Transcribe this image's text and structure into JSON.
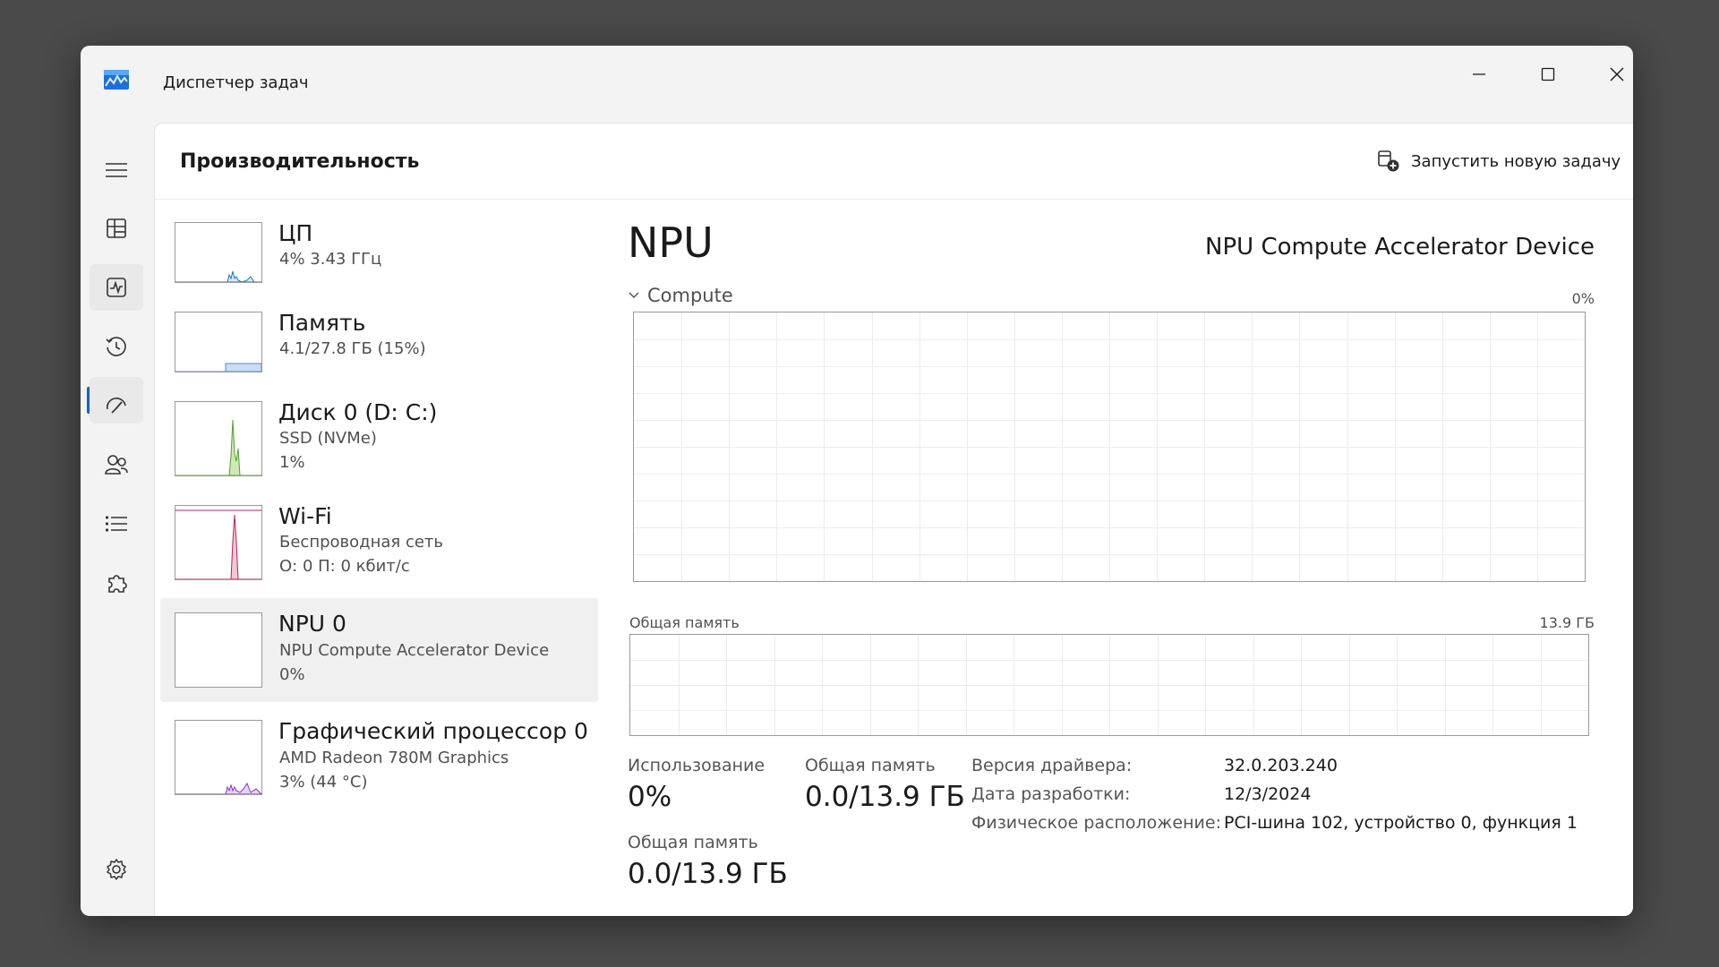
{
  "window": {
    "title": "Диспетчер задач"
  },
  "panel": {
    "title": "Производительность",
    "run_task_label": "Запустить новую задачу"
  },
  "devices": [
    {
      "name": "ЦП",
      "line1": "4% 3.43 ГГц",
      "line2": "",
      "color": "#1779c4"
    },
    {
      "name": "Память",
      "line1": "4.1/27.8 ГБ (15%)",
      "line2": "",
      "color": "#4a8fd6"
    },
    {
      "name": "Диск 0 (D: C:)",
      "line1": "SSD (NVMe)",
      "line2": "1%",
      "color": "#4fa32a"
    },
    {
      "name": "Wi-Fi",
      "line1": "Беспроводная сеть",
      "line2": "О: 0 П: 0 кбит/с",
      "color": "#b3265c"
    },
    {
      "name": "NPU 0",
      "line1": "NPU Compute Accelerator Device",
      "line2": "0%",
      "color": "#6a6a6a"
    },
    {
      "name": "Графический процессор 0",
      "line1": "AMD Radeon 780M Graphics",
      "line2": "3% (44 °C)",
      "color": "#8e35c7"
    }
  ],
  "detail": {
    "title": "NPU",
    "device_name": "NPU Compute Accelerator Device",
    "compute_label": "Compute",
    "compute_max": "0%",
    "memory_label": "Общая память",
    "memory_max": "13.9 ГБ",
    "stats": {
      "usage_label": "Использование",
      "usage_value": "0%",
      "shared1_label": "Общая память",
      "shared1_value": "0.0/13.9 ГБ",
      "shared2_label": "Общая память",
      "shared2_value": "0.0/13.9 ГБ"
    },
    "info": {
      "driver_label": "Версия драйвера:",
      "driver_value": "32.0.203.240",
      "date_label": "Дата разработки:",
      "date_value": "12/3/2024",
      "location_label": "Физическое расположение:",
      "location_value": "PCI-шина 102, устройство 0, функция 1"
    }
  },
  "colors": {
    "accent": "#0067c0",
    "grid": "#ececec",
    "border": "#9a9a9a"
  }
}
